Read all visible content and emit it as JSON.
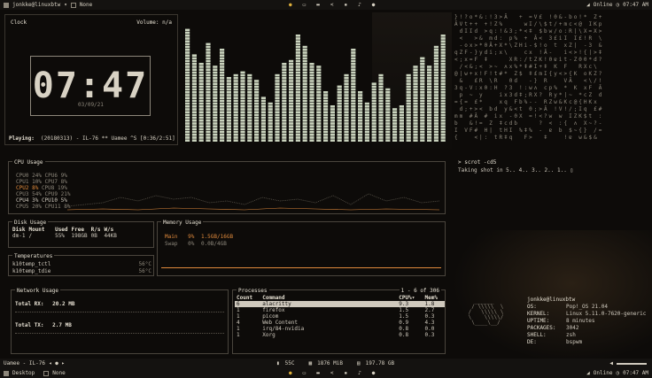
{
  "topbar": {
    "user": "jonkke@linuxbtw",
    "session": "None",
    "wifi": "Online",
    "time": "07:47 AM"
  },
  "clock": {
    "title": "Clock",
    "volume": "Volume: n/a",
    "digits": "07:47",
    "date": "03/09/21",
    "playing_label": "Playing:",
    "playing": "(20180313) - IL-76 ** Uamee ^S [0:36/2:51]"
  },
  "visualizer": {
    "bars": [
      0.93,
      0.72,
      0.65,
      0.8,
      0.62,
      0.76,
      0.53,
      0.56,
      0.58,
      0.55,
      0.52,
      0.37,
      0.33,
      0.55,
      0.65,
      0.67,
      0.88,
      0.79,
      0.64,
      0.62,
      0.42,
      0.31,
      0.47,
      0.57,
      0.76,
      0.43,
      0.32,
      0.5,
      0.57,
      0.44,
      0.28,
      0.3,
      0.57,
      0.62,
      0.7,
      0.62,
      0.78,
      0.87
    ]
  },
  "cpu": {
    "title": "CPU Usage",
    "rows": [
      {
        "name": "CPU0",
        "val": "24%",
        "name2": "CPU6",
        "val2": "9%"
      },
      {
        "name": "CPU1",
        "val": "10%",
        "name2": "CPU7",
        "val2": "8%"
      },
      {
        "name": "CPU2",
        "val": "8%",
        "name2": "CPU8",
        "val2": "19%"
      },
      {
        "name": "CPU3",
        "val": "54%",
        "name2": "CPU9",
        "val2": "21%"
      },
      {
        "name": "CPU4",
        "val": "3%",
        "name2": "CPU10",
        "val2": "5%"
      },
      {
        "name": "CPU5",
        "val": "20%",
        "name2": "CPU11",
        "val2": "8%"
      }
    ]
  },
  "disk": {
    "title": "Disk Usage",
    "headers": [
      "Disk",
      "Mount",
      "Used",
      "Free",
      "R/s",
      "W/s"
    ],
    "row": [
      "dm-1",
      "/",
      "55%",
      "198GB",
      "0B",
      "44KB"
    ]
  },
  "memory": {
    "title": "Memory Usage",
    "main_label": "Main",
    "main_pct": "9%",
    "main_val": "1.5GB/16GB",
    "swap_label": "Swap",
    "swap_pct": "0%",
    "swap_val": "0.0B/4GB"
  },
  "temps": {
    "title": "Temperatures",
    "rows": [
      {
        "name": "k10temp_tctl",
        "val": "56°C"
      },
      {
        "name": "k10temp_tdie",
        "val": "56°C"
      }
    ]
  },
  "network": {
    "title": "Network Usage",
    "rx_label": "Total RX:",
    "rx_val": "20.2 MB",
    "tx_label": "Total TX:",
    "tx_val": "2.7 MB"
  },
  "processes": {
    "title": "Processes",
    "counter": "1 - 6 of 306",
    "headers": [
      "Count",
      "Command",
      "CPU%▾",
      "Mem%"
    ],
    "rows": [
      [
        "6",
        "alacritty",
        "9.3",
        "1.8"
      ],
      [
        "1",
        "firefox",
        "1.5",
        "2.7"
      ],
      [
        "1",
        "picom",
        "1.5",
        "0.3"
      ],
      [
        "4",
        "Web Content",
        "0.9",
        "4.3"
      ],
      [
        "1",
        "irq/84-nvidia",
        "0.8",
        "0.0"
      ],
      [
        "1",
        "Xorg",
        "0.8",
        "0.3"
      ]
    ]
  },
  "terminal": {
    "prompt": "> scrot -cd5",
    "output": "Taking shot in 5.. 4.. 3.. 2.. 1.. ▯"
  },
  "neofetch": {
    "userhost": "jonkke@linuxbtw",
    "rows": [
      {
        "k": "OS:",
        "v": "Pop!_OS 21.04"
      },
      {
        "k": "KERNEL:",
        "v": "Linux 5.11.0-7620-generic"
      },
      {
        "k": "UPTIME:",
        "v": "8 minutes"
      },
      {
        "k": "PACKAGES:",
        "v": "3042"
      },
      {
        "k": "SHELL:",
        "v": "zsh"
      },
      {
        "k": "DE:",
        "v": "bspwm"
      }
    ]
  },
  "bottombar": {
    "music": "Uamee - IL-76",
    "temp": "55C",
    "ram": "1876 MiB",
    "disk": "197.78 GB",
    "desktop": "Desktop",
    "session": "None",
    "wifi": "Online",
    "time": "07:47 AM"
  },
  "colors": {
    "accent": "#e08a3c",
    "border": "#4a453d",
    "viz": "#c9d3bd"
  }
}
